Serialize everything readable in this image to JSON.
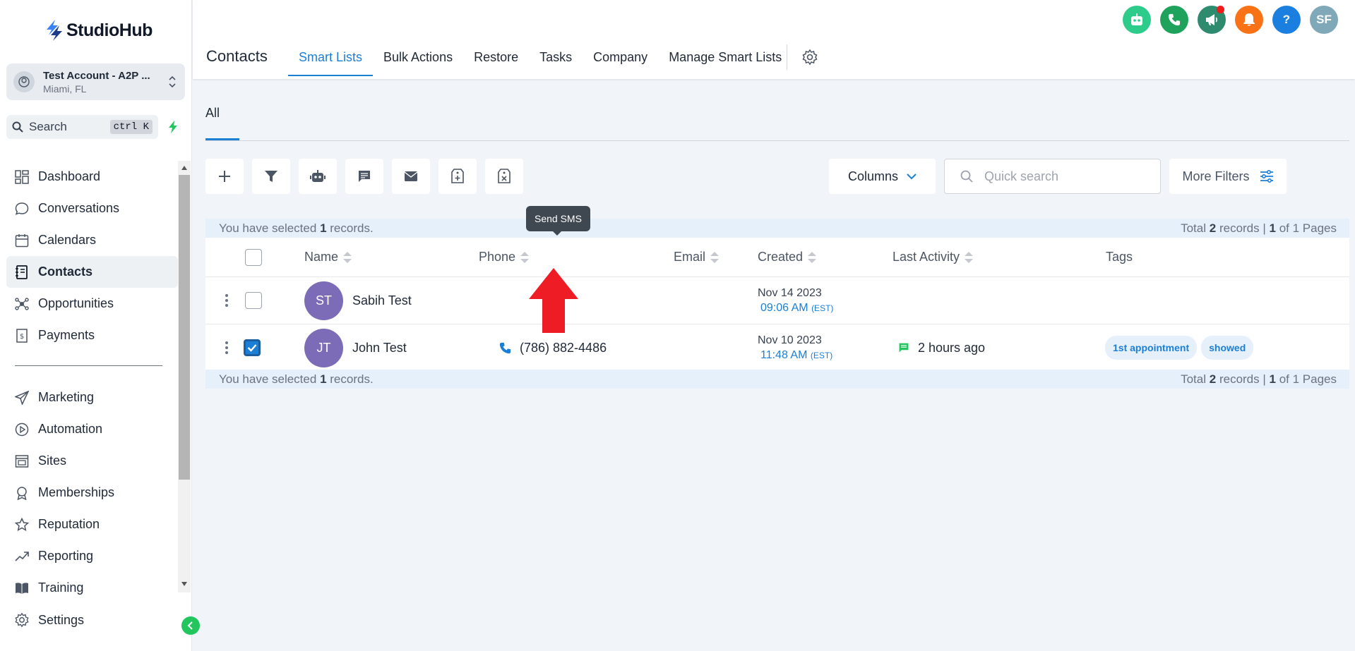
{
  "sidebar": {
    "logo_text": "StudioHub",
    "account": {
      "name": "Test Account - A2P ...",
      "location": "Miami, FL"
    },
    "search": {
      "label": "Search",
      "shortcut": "ctrl K"
    },
    "nav_top": [
      {
        "label": "Dashboard",
        "icon": "dashboard-icon"
      },
      {
        "label": "Conversations",
        "icon": "chat-bubble-icon"
      },
      {
        "label": "Calendars",
        "icon": "calendar-icon"
      },
      {
        "label": "Contacts",
        "icon": "contacts-book-icon",
        "active": true
      },
      {
        "label": "Opportunities",
        "icon": "opportunities-icon"
      },
      {
        "label": "Payments",
        "icon": "payments-icon"
      }
    ],
    "nav_bottom": [
      {
        "label": "Marketing",
        "icon": "send-icon"
      },
      {
        "label": "Automation",
        "icon": "automation-icon"
      },
      {
        "label": "Sites",
        "icon": "sites-icon"
      },
      {
        "label": "Memberships",
        "icon": "membership-badge-icon"
      },
      {
        "label": "Reputation",
        "icon": "star-icon"
      },
      {
        "label": "Reporting",
        "icon": "trend-icon"
      },
      {
        "label": "Training",
        "icon": "book-icon"
      }
    ],
    "settings_label": "Settings"
  },
  "header": {
    "title": "Contacts",
    "tabs": [
      {
        "label": "Smart Lists",
        "active": true
      },
      {
        "label": "Bulk Actions"
      },
      {
        "label": "Restore"
      },
      {
        "label": "Tasks"
      },
      {
        "label": "Company"
      },
      {
        "label": "Manage Smart Lists"
      }
    ],
    "top_icons": [
      {
        "name": "ai-bot-icon",
        "color": "#2ecc8a"
      },
      {
        "name": "phone-icon",
        "color": "#1fa35c"
      },
      {
        "name": "megaphone-icon",
        "color": "#2e8b6e",
        "dot": true
      },
      {
        "name": "bell-icon",
        "color": "#f97316"
      },
      {
        "name": "help-icon",
        "color": "#1b7fe0",
        "text": "?"
      },
      {
        "name": "user-avatar",
        "color": "#7fa8b8",
        "text": "SF"
      }
    ]
  },
  "main": {
    "view_tab": "All",
    "tooltip": "Send SMS",
    "columns_label": "Columns",
    "quick_search_placeholder": "Quick search",
    "more_filters_label": "More Filters",
    "selection": {
      "prefix": "You have selected",
      "count": "1",
      "suffix": "records."
    },
    "total": {
      "prefix": "Total",
      "records": "2",
      "records_word": "records |",
      "page": "1",
      "of_pages": "of 1 Pages"
    },
    "columns": [
      "Name",
      "Phone",
      "Email",
      "Created",
      "Last Activity",
      "Tags"
    ],
    "rows": [
      {
        "initials": "ST",
        "name": "Sabih Test",
        "phone": "",
        "email": "",
        "created_date": "Nov 14 2023",
        "created_time": "09:06 AM",
        "tz": "(EST)",
        "last_activity": "",
        "tags": [],
        "checked": false
      },
      {
        "initials": "JT",
        "name": "John Test",
        "phone": "(786) 882-4486",
        "email": "",
        "created_date": "Nov 10 2023",
        "created_time": "11:48 AM",
        "tz": "(EST)",
        "last_activity": "2 hours ago",
        "tags": [
          "1st appointment",
          "showed"
        ],
        "checked": true
      }
    ]
  },
  "colors": {
    "accent": "#1b7fd6",
    "avatar": "#7c6cb8",
    "arrow": "#ee1c25",
    "activity": "#22c55e"
  }
}
